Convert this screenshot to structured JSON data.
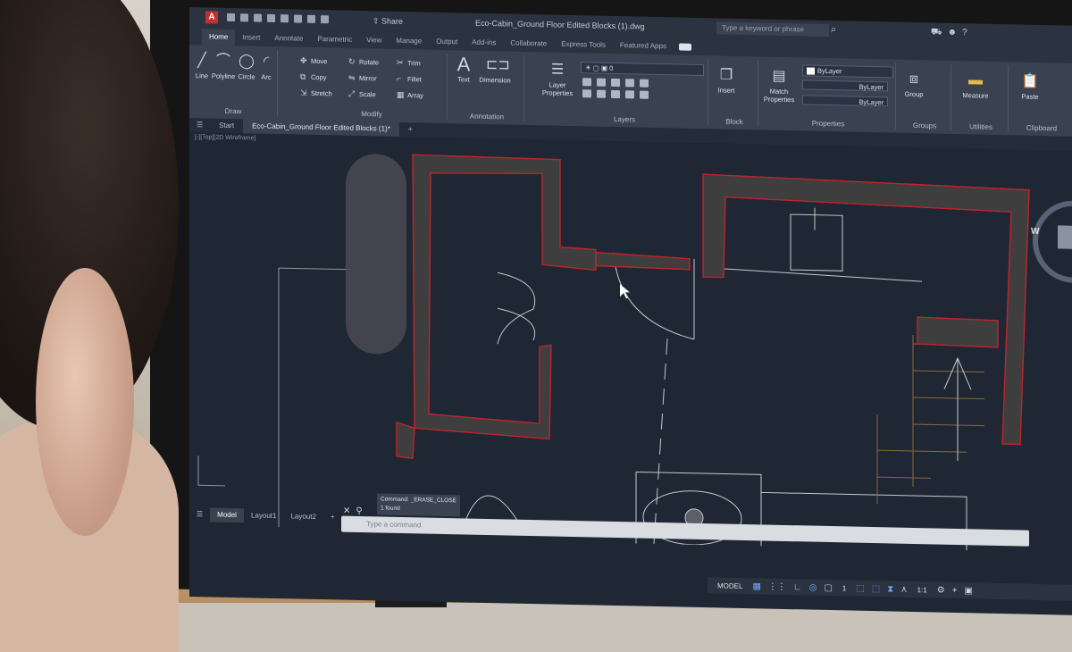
{
  "window": {
    "title": "Eco-Cabin_Ground Floor Edited Blocks (1).dwg",
    "app_icon_letter": "A",
    "share_label": "Share",
    "search_placeholder": "Type a keyword or phrase"
  },
  "ribbon_tabs": [
    "Home",
    "Insert",
    "Annotate",
    "Parametric",
    "View",
    "Manage",
    "Output",
    "Add-ins",
    "Collaborate",
    "Express Tools",
    "Featured Apps"
  ],
  "active_ribbon_tab": "Home",
  "panels": {
    "draw": {
      "title": "Draw",
      "tools": [
        "Line",
        "Polyline",
        "Circle",
        "Arc"
      ]
    },
    "modify": {
      "title": "Modify",
      "tools": [
        "Move",
        "Rotate",
        "Trim",
        "Copy",
        "Mirror",
        "Fillet",
        "Stretch",
        "Scale",
        "Array"
      ]
    },
    "annotation": {
      "title": "Annotation",
      "tools": [
        "Text",
        "Dimension"
      ]
    },
    "layers": {
      "title": "Layers",
      "layer_properties_label": "Layer Properties",
      "current_layer": "0"
    },
    "block": {
      "title": "Block",
      "insert_label": "Insert"
    },
    "properties": {
      "title": "Properties",
      "match_label": "Match Properties",
      "color": "ByLayer",
      "linetype": "ByLayer",
      "lineweight": "ByLayer"
    },
    "groups": {
      "title": "Groups",
      "group_label": "Group"
    },
    "utilities": {
      "title": "Utilities",
      "measure_label": "Measure"
    },
    "clipboard": {
      "title": "Clipboard",
      "paste_label": "Paste"
    }
  },
  "file_tabs": {
    "start": "Start",
    "active": "Eco-Cabin_Ground Floor Edited Blocks (1)*",
    "add": "+"
  },
  "viewport_label": "[-][Top][2D Wireframe]",
  "viewcube": {
    "west": "W"
  },
  "command": {
    "history_1": "Command: _ERASE_CLOSE",
    "history_2": "1 found",
    "placeholder": "Type a command"
  },
  "layout_tabs": [
    "Model",
    "Layout1",
    "Layout2"
  ],
  "status": {
    "model": "MODEL",
    "scale": "1",
    "annotation_scale": "1:1"
  },
  "colors": {
    "wall_fill": "#3e3e3e",
    "wall_outline": "#c0242b",
    "linework": "#c8c8c8",
    "canvas": "#1f2735",
    "ribbon": "#3a4150"
  }
}
